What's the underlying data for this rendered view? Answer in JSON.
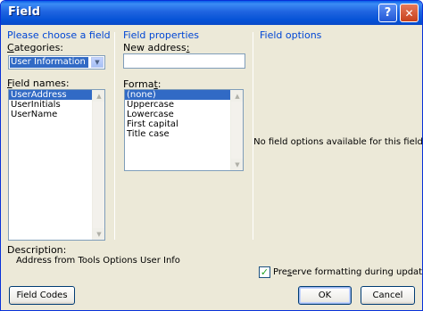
{
  "window": {
    "title": "Field",
    "help_glyph": "?",
    "close_glyph": "✕"
  },
  "choose": {
    "heading": "Please choose a field",
    "categories_label_u": "C",
    "categories_label_rest": "ategories:",
    "category_value": "User Information",
    "field_names_label_u": "F",
    "field_names_label_rest": "ield names:",
    "field_names": [
      {
        "label": "UserAddress",
        "selected": true
      },
      {
        "label": "UserInitials",
        "selected": false
      },
      {
        "label": "UserName",
        "selected": false
      }
    ]
  },
  "properties": {
    "heading": "Field properties",
    "new_address_label_pre": "New address",
    "new_address_label_u": ":",
    "new_address_value": "",
    "format_label_pre": "Forma",
    "format_label_u": "t",
    "format_label_post": ":",
    "formats": [
      {
        "label": "(none)",
        "selected": true
      },
      {
        "label": "Uppercase",
        "selected": false
      },
      {
        "label": "Lowercase",
        "selected": false
      },
      {
        "label": "First capital",
        "selected": false
      },
      {
        "label": "Title case",
        "selected": false
      }
    ]
  },
  "options": {
    "heading": "Field options",
    "empty_message": "No field options available for this field"
  },
  "description": {
    "label": "Description:",
    "text": "Address from Tools Options User Info"
  },
  "preserve": {
    "checked": true,
    "label_pre": "Pre",
    "label_u": "s",
    "label_post": "erve formatting during updates"
  },
  "buttons": {
    "field_codes": "Field Codes",
    "ok": "OK",
    "cancel": "Cancel"
  }
}
